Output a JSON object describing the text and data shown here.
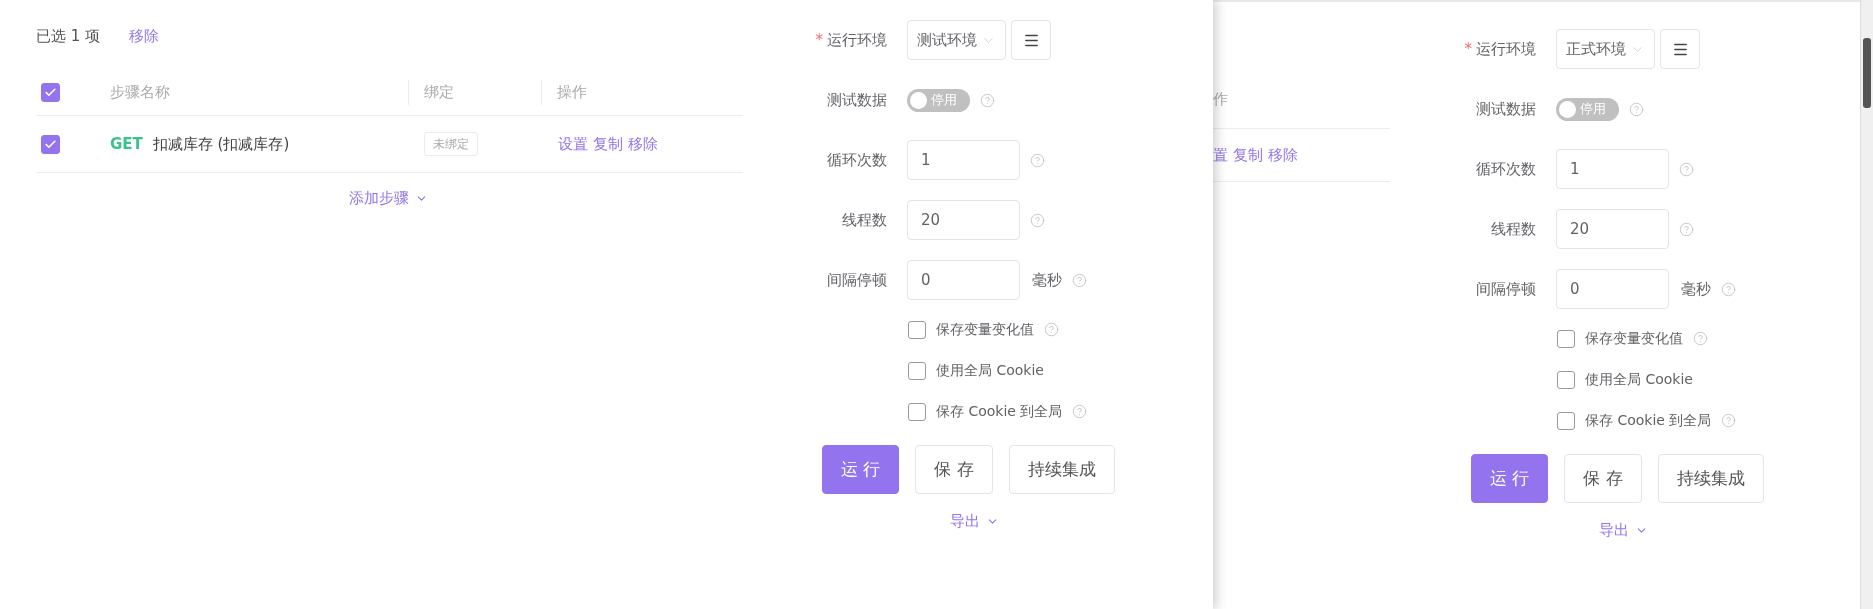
{
  "left_panel": {
    "selection": {
      "text": "已选 1 项",
      "action": "移除"
    },
    "table": {
      "header_checked": true,
      "columns": [
        "步骤名称",
        "绑定",
        "操作"
      ],
      "rows": [
        {
          "checked": true,
          "method": "GET",
          "name": "扣减库存 (扣减库存)",
          "binding": "未绑定",
          "actions": [
            "设置",
            "复制",
            "移除"
          ]
        }
      ]
    },
    "add_step": "添加步骤",
    "form": {
      "fields": [
        {
          "kind": "select",
          "label": "运行环境",
          "marker": "*",
          "value": "测试环境"
        },
        {
          "kind": "switch",
          "label": "测试数据",
          "on": false,
          "text": "停用",
          "help": true
        },
        {
          "kind": "input",
          "label": "循环次数",
          "value": "1",
          "help": true
        },
        {
          "kind": "input",
          "label": "线程数",
          "value": "20",
          "help": true
        },
        {
          "kind": "input",
          "label": "间隔停顿",
          "value": "0",
          "unit": "毫秒",
          "help": true
        }
      ],
      "options": [
        {
          "label": "保存变量变化值",
          "checked": false,
          "help": true
        },
        {
          "label": "使用全局 Cookie",
          "checked": false,
          "help": false
        },
        {
          "label": "保存 Cookie 到全局",
          "checked": false,
          "help": true
        }
      ],
      "buttons": [
        {
          "label": "运 行",
          "primary": true
        },
        {
          "label": "保 存",
          "primary": false
        },
        {
          "label": "持续集成",
          "primary": false
        }
      ],
      "export": "导出"
    }
  },
  "right_panel": {
    "table": {
      "columns": [
        "作"
      ],
      "rows": [
        {
          "actions": [
            "置",
            "复制",
            "移除"
          ]
        }
      ]
    },
    "form": {
      "fields": [
        {
          "kind": "select",
          "label": "运行环境",
          "marker": "*",
          "value": "正式环境"
        },
        {
          "kind": "switch",
          "label": "测试数据",
          "on": false,
          "text": "停用",
          "help": true
        },
        {
          "kind": "input",
          "label": "循环次数",
          "value": "1",
          "help": true
        },
        {
          "kind": "input",
          "label": "线程数",
          "value": "20",
          "help": true
        },
        {
          "kind": "input",
          "label": "间隔停顿",
          "value": "0",
          "unit": "毫秒",
          "help": true
        }
      ],
      "options": [
        {
          "label": "保存变量变化值",
          "checked": false,
          "help": true
        },
        {
          "label": "使用全局 Cookie",
          "checked": false,
          "help": false
        },
        {
          "label": "保存 Cookie 到全局",
          "checked": false,
          "help": true
        }
      ],
      "buttons": [
        {
          "label": "运 行",
          "primary": true
        },
        {
          "label": "保 存",
          "primary": false
        },
        {
          "label": "持续集成",
          "primary": false
        }
      ],
      "export": "导出"
    }
  }
}
